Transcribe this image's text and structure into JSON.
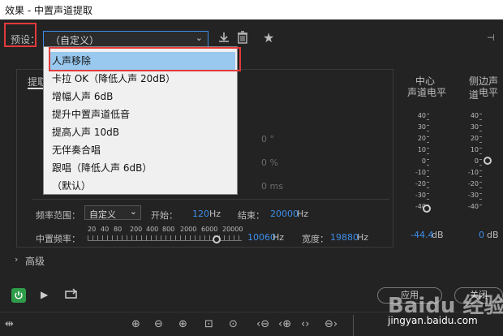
{
  "window": {
    "title": "效果 - 中置声道提取"
  },
  "preset": {
    "label": "预设：",
    "selected": "（自定义）"
  },
  "dropdown": {
    "items": [
      {
        "label": "人声移除"
      },
      {
        "label": "卡拉 OK（降低人声 20dB）"
      },
      {
        "label": "增幅人声 6dB"
      },
      {
        "label": "提升中置声道低音"
      },
      {
        "label": "提高人声 10dB"
      },
      {
        "label": "无伴奏合唱"
      },
      {
        "label": "跟唱（降低人声 6dB）"
      },
      {
        "label": "（默认）"
      }
    ]
  },
  "tabs": {
    "extract": "提取"
  },
  "hidden_values": {
    "v1": "0 °",
    "v2": "0 %",
    "v3": "0 ms"
  },
  "freq": {
    "range_label": "频率范围：",
    "range_value": "自定义",
    "start_label": "开始：",
    "start_value": "120",
    "start_unit": "Hz",
    "end_label": "结束：",
    "end_value": "20000",
    "end_unit": "Hz",
    "center_label": "中置频率：",
    "center_value": "10060",
    "center_unit": "Hz",
    "width_label": "宽度：",
    "width_value": "19880",
    "width_unit": "Hz",
    "scale": [
      "20",
      "40",
      "80",
      "200",
      "400",
      "800",
      "2000",
      "6000",
      "20000"
    ]
  },
  "meters": {
    "center_title_1": "中心",
    "center_title_2": "声道电平",
    "side_title_1": "侧边声道",
    "side_title_2": "电平",
    "scale": [
      "40",
      "30",
      "20",
      "10",
      "0",
      "-10",
      "-20",
      "-30",
      "-40"
    ],
    "center_value": "-44.4",
    "center_unit": "dB",
    "side_value": "0",
    "side_unit": "dB"
  },
  "advanced": {
    "label": "高级"
  },
  "footer": {
    "apply": "应用",
    "close": "关闭"
  },
  "watermark": {
    "text": "Baidu 经验",
    "url": "jingyan.baidu.com"
  }
}
